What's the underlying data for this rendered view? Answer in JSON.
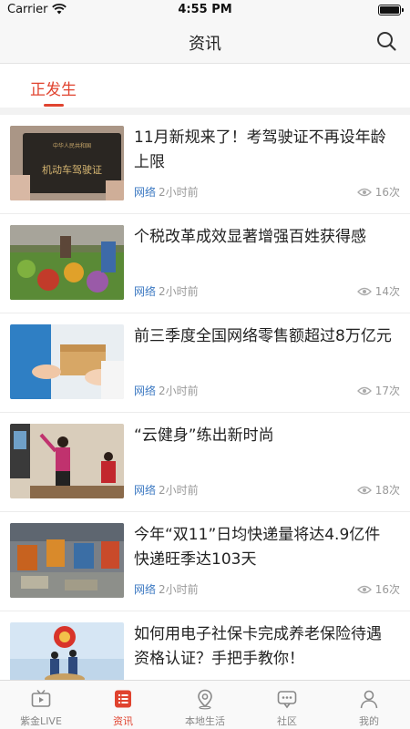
{
  "status_bar": {
    "carrier": "Carrier",
    "time": "4:55 PM",
    "battery_level": 1.0
  },
  "nav": {
    "title": "资讯",
    "search_icon": "search-icon"
  },
  "tabs": [
    {
      "label": "正发生",
      "active": true
    }
  ],
  "news": [
    {
      "title": "11月新规来了！考驾驶证不再设年龄上限",
      "source": "网络",
      "time": "2小时前",
      "views": "16次"
    },
    {
      "title": "个税改革成效显著增强百姓获得感",
      "source": "网络",
      "time": "2小时前",
      "views": "14次"
    },
    {
      "title": "前三季度全国网络零售额超过8万亿元",
      "source": "网络",
      "time": "2小时前",
      "views": "17次"
    },
    {
      "title": "“云健身”练出新时尚",
      "source": "网络",
      "time": "2小时前",
      "views": "18次"
    },
    {
      "title": "今年“双11”日均快递量将达4.9亿件 快递旺季达103天",
      "source": "网络",
      "time": "2小时前",
      "views": "16次"
    },
    {
      "title": "如何用电子社保卡完成养老保险待遇资格认证？手把手教你！",
      "source": "网络",
      "time": "2小时前",
      "views": ""
    }
  ],
  "thumb_text": {
    "license_small": "中华人民共和国",
    "license_main": "机动车驾驶证"
  },
  "bottom_tabs": [
    {
      "label": "紫金LIVE",
      "icon": "tv-icon",
      "active": false
    },
    {
      "label": "资讯",
      "icon": "news-list-icon",
      "active": true
    },
    {
      "label": "本地生活",
      "icon": "location-pin-icon",
      "active": false
    },
    {
      "label": "社区",
      "icon": "chat-bubble-icon",
      "active": false
    },
    {
      "label": "我的",
      "icon": "person-icon",
      "active": false
    }
  ],
  "colors": {
    "accent": "#e0432f",
    "source_blue": "#3c79c2",
    "meta_gray": "#999999"
  }
}
